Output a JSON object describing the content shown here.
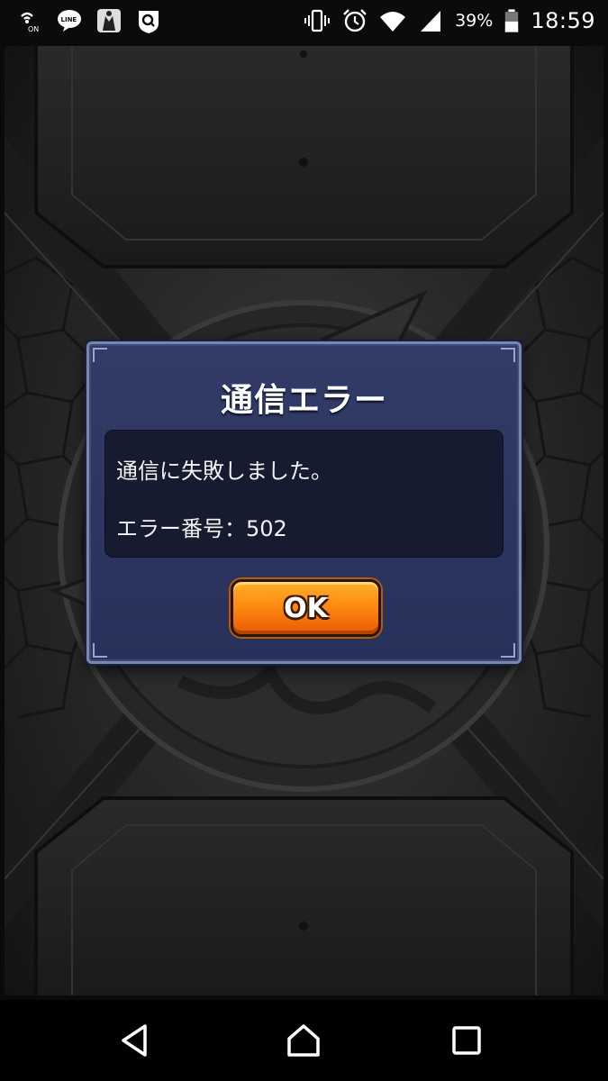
{
  "status_bar": {
    "battery_percent": "39%",
    "time": "18:59",
    "icons": [
      "nfc-on-icon",
      "line-app-icon",
      "butler-app-icon",
      "search-app-icon",
      "vibrate-icon",
      "alarm-icon",
      "wifi-icon",
      "signal-icon",
      "battery-icon"
    ]
  },
  "dialog": {
    "title": "通信エラー",
    "message_line1": "通信に失敗しました。",
    "message_line2": "エラー番号：502",
    "ok_label": "OK"
  },
  "colors": {
    "dialog_bg": "#2d3662",
    "message_bg": "#161b2f",
    "ok_button": "#ff8a12"
  },
  "nav_bar": {
    "icons": [
      "back-icon",
      "home-icon",
      "recent-apps-icon"
    ]
  }
}
